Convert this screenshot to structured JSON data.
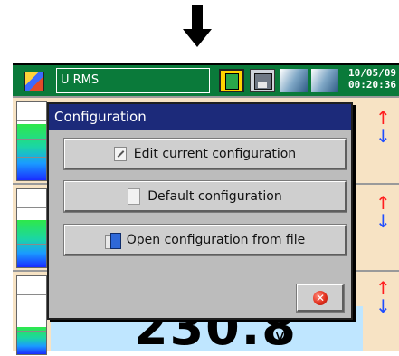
{
  "status_bar": {
    "title": "U RMS",
    "date": "10/05/09",
    "time": "00:20:36"
  },
  "dialog": {
    "title": "Configuration",
    "buttons": [
      {
        "label": "Edit current configuration",
        "icon": "edit-document-icon"
      },
      {
        "label": "Default configuration",
        "icon": "blank-document-icon"
      },
      {
        "label": "Open configuration from file",
        "icon": "open-file-icon"
      }
    ],
    "close_icon": "close-icon"
  },
  "channels": [
    {
      "gauge_fill_fraction": 0.72
    },
    {
      "gauge_fill_fraction": 0.6
    },
    {
      "gauge_fill_fraction": 0.35
    }
  ],
  "measurement": {
    "value": "230.8",
    "unit": "v"
  },
  "colors": {
    "status_bar_bg": "#0a7a3a",
    "dialog_title_bg": "#1c2a7a",
    "panel_bg": "#f7e3c4",
    "value_bg": "#bfe6ff",
    "up_arrow": "#ff1f1f",
    "down_arrow": "#1f4dff"
  }
}
